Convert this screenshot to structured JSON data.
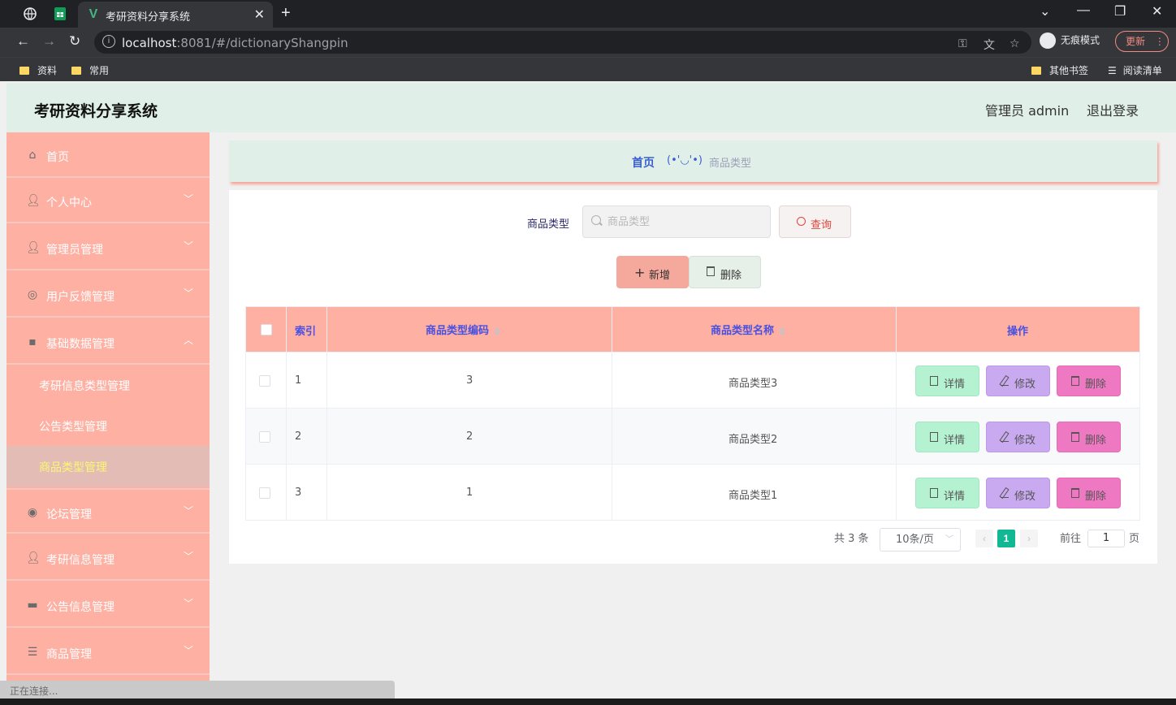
{
  "browser": {
    "tab_title": "考研资料分享系统",
    "url_host": "localhost",
    "url_rest": ":8081/#/dictionaryShangpin",
    "incognito_label": "无痕模式",
    "update_label": "更新",
    "bookmarks": [
      "资料",
      "常用"
    ],
    "other_bookmarks": "其他书签",
    "reading_list": "阅读清单",
    "status": "正在连接..."
  },
  "header": {
    "brand": "考研资料分享系统",
    "user": "管理员 admin",
    "logout": "退出登录"
  },
  "sidebar": {
    "items": [
      {
        "label": "首页",
        "icon": "home-icon"
      },
      {
        "label": "个人中心",
        "icon": "user-icon"
      },
      {
        "label": "管理员管理",
        "icon": "user-icon"
      },
      {
        "label": "用户反馈管理",
        "icon": "compass-icon"
      },
      {
        "label": "基础数据管理",
        "icon": "chat-icon"
      },
      {
        "label": "论坛管理",
        "icon": "lifebuoy-icon"
      },
      {
        "label": "考研信息管理",
        "icon": "user-icon"
      },
      {
        "label": "公告信息管理",
        "icon": "monitor-icon"
      },
      {
        "label": "商品管理",
        "icon": "sliders-icon"
      }
    ],
    "sub_items": [
      {
        "label": "考研信息类型管理"
      },
      {
        "label": "公告类型管理"
      },
      {
        "label": "商品类型管理"
      }
    ]
  },
  "breadcrumb": {
    "home": "首页",
    "face": "(•'◡'•)",
    "current": "商品类型"
  },
  "search": {
    "label": "商品类型",
    "placeholder": "商品类型",
    "query_label": "查询"
  },
  "actions": {
    "add_label": "新增",
    "delete_label": "删除"
  },
  "table": {
    "headers": [
      "索引",
      "商品类型编码",
      "商品类型名称",
      "操作"
    ],
    "rows": [
      {
        "index": "1",
        "code": "3",
        "name": "商品类型3"
      },
      {
        "index": "2",
        "code": "2",
        "name": "商品类型2"
      },
      {
        "index": "3",
        "code": "1",
        "name": "商品类型1"
      }
    ],
    "row_actions": {
      "detail": "详情",
      "edit": "修改",
      "remove": "删除"
    }
  },
  "pagination": {
    "total": "共 3 条",
    "page_size": "10条/页",
    "current_page": "1",
    "goto_label": "前往",
    "goto_value": "1",
    "page_suffix": "页"
  },
  "colors": {
    "sidebar_bg": "#feb0a3",
    "header_bg": "#e0efe8",
    "active_submenu_text": "#f9f871",
    "detail_btn": "#b5f2d2",
    "edit_btn": "#c9a9ef",
    "remove_btn": "#ef78c2",
    "page_active": "#11b893"
  }
}
